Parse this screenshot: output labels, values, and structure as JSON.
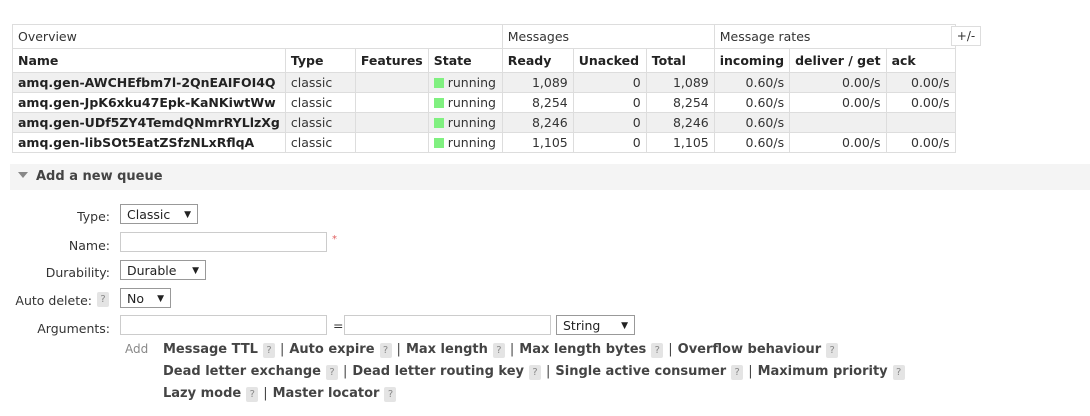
{
  "table": {
    "groups": {
      "overview": "Overview",
      "messages": "Messages",
      "message_rates": "Message rates"
    },
    "plus_minus": "+/-",
    "columns": {
      "name": "Name",
      "type": "Type",
      "features": "Features",
      "state": "State",
      "ready": "Ready",
      "unacked": "Unacked",
      "total": "Total",
      "incoming": "incoming",
      "deliver_get": "deliver / get",
      "ack": "ack"
    },
    "rows": [
      {
        "name": "amq.gen-AWCHEfbm7l-2QnEAIFOI4Q",
        "type": "classic",
        "features": "",
        "state": "running",
        "ready": "1,089",
        "unacked": "0",
        "total": "1,089",
        "incoming": "0.60/s",
        "deliver_get": "0.00/s",
        "ack": "0.00/s"
      },
      {
        "name": "amq.gen-JpK6xku47Epk-KaNKiwtWw",
        "type": "classic",
        "features": "",
        "state": "running",
        "ready": "8,254",
        "unacked": "0",
        "total": "8,254",
        "incoming": "0.60/s",
        "deliver_get": "0.00/s",
        "ack": "0.00/s"
      },
      {
        "name": "amq.gen-UDf5ZY4TemdQNmrRYLlzXg",
        "type": "classic",
        "features": "",
        "state": "running",
        "ready": "8,246",
        "unacked": "0",
        "total": "8,246",
        "incoming": "0.60/s",
        "deliver_get": "",
        "ack": ""
      },
      {
        "name": "amq.gen-libSOt5EatZSfzNLxRflqA",
        "type": "classic",
        "features": "",
        "state": "running",
        "ready": "1,105",
        "unacked": "0",
        "total": "1,105",
        "incoming": "0.60/s",
        "deliver_get": "0.00/s",
        "ack": "0.00/s"
      }
    ],
    "state_color": "#80f080"
  },
  "add_queue": {
    "title": "Add a new queue",
    "type_label": "Type:",
    "type_value": "Classic",
    "name_label": "Name:",
    "name_value": "",
    "required_mark": "*",
    "durability_label": "Durability:",
    "durability_value": "Durable",
    "auto_delete_label": "Auto delete:",
    "auto_delete_help": "?",
    "auto_delete_value": "No",
    "arguments_label": "Arguments:",
    "arg_key": "",
    "equals": "=",
    "arg_value": "",
    "arg_type": "String",
    "add_label": "Add",
    "help_mark": "?",
    "separator": "|",
    "shortcuts": [
      "Message TTL",
      "Auto expire",
      "Max length",
      "Max length bytes",
      "Overflow behaviour",
      "Dead letter exchange",
      "Dead letter routing key",
      "Single active consumer",
      "Maximum priority",
      "Lazy mode",
      "Master locator"
    ]
  }
}
